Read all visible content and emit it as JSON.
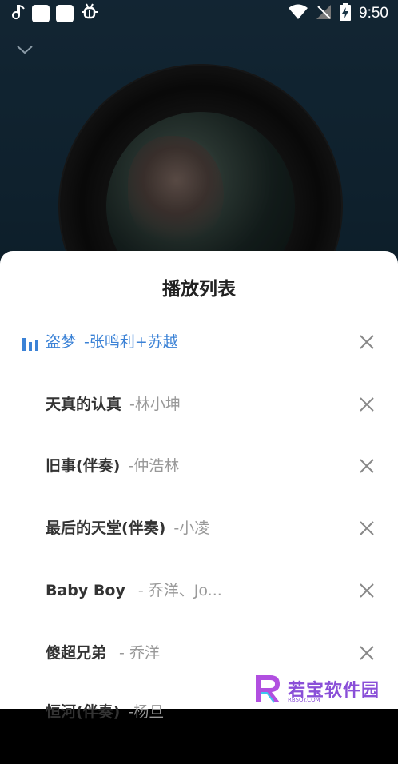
{
  "status_bar": {
    "time": "9:50",
    "left_icons": [
      "music-note-icon",
      "notification-square-icon",
      "notification-square-icon",
      "bug-icon"
    ],
    "right_icons": [
      "wifi-icon",
      "no-signal-icon",
      "battery-charging-icon"
    ]
  },
  "player": {
    "collapse_icon": "chevron-down-icon"
  },
  "playlist": {
    "title": "播放列表",
    "accent_color": "#3b82d6",
    "tracks": [
      {
        "name": "盗梦",
        "artist": "-张鸣利+苏越",
        "playing": true
      },
      {
        "name": "天真的认真",
        "artist": "-林小坤",
        "playing": false
      },
      {
        "name": "旧事(伴奏)",
        "artist": "-仲浩林",
        "playing": false
      },
      {
        "name": "最后的天堂(伴奏)",
        "artist": "-小凌",
        "playing": false
      },
      {
        "name": "Baby Boy",
        "artist": " - 乔洋、Jo...",
        "playing": false
      },
      {
        "name": "傻超兄弟",
        "artist": " - 乔洋",
        "playing": false
      },
      {
        "name": "恒河(伴奏)",
        "artist": "-杨旦",
        "playing": false
      }
    ]
  },
  "watermark": {
    "text": "若宝软件园",
    "sub": "RBSOY.COM"
  }
}
